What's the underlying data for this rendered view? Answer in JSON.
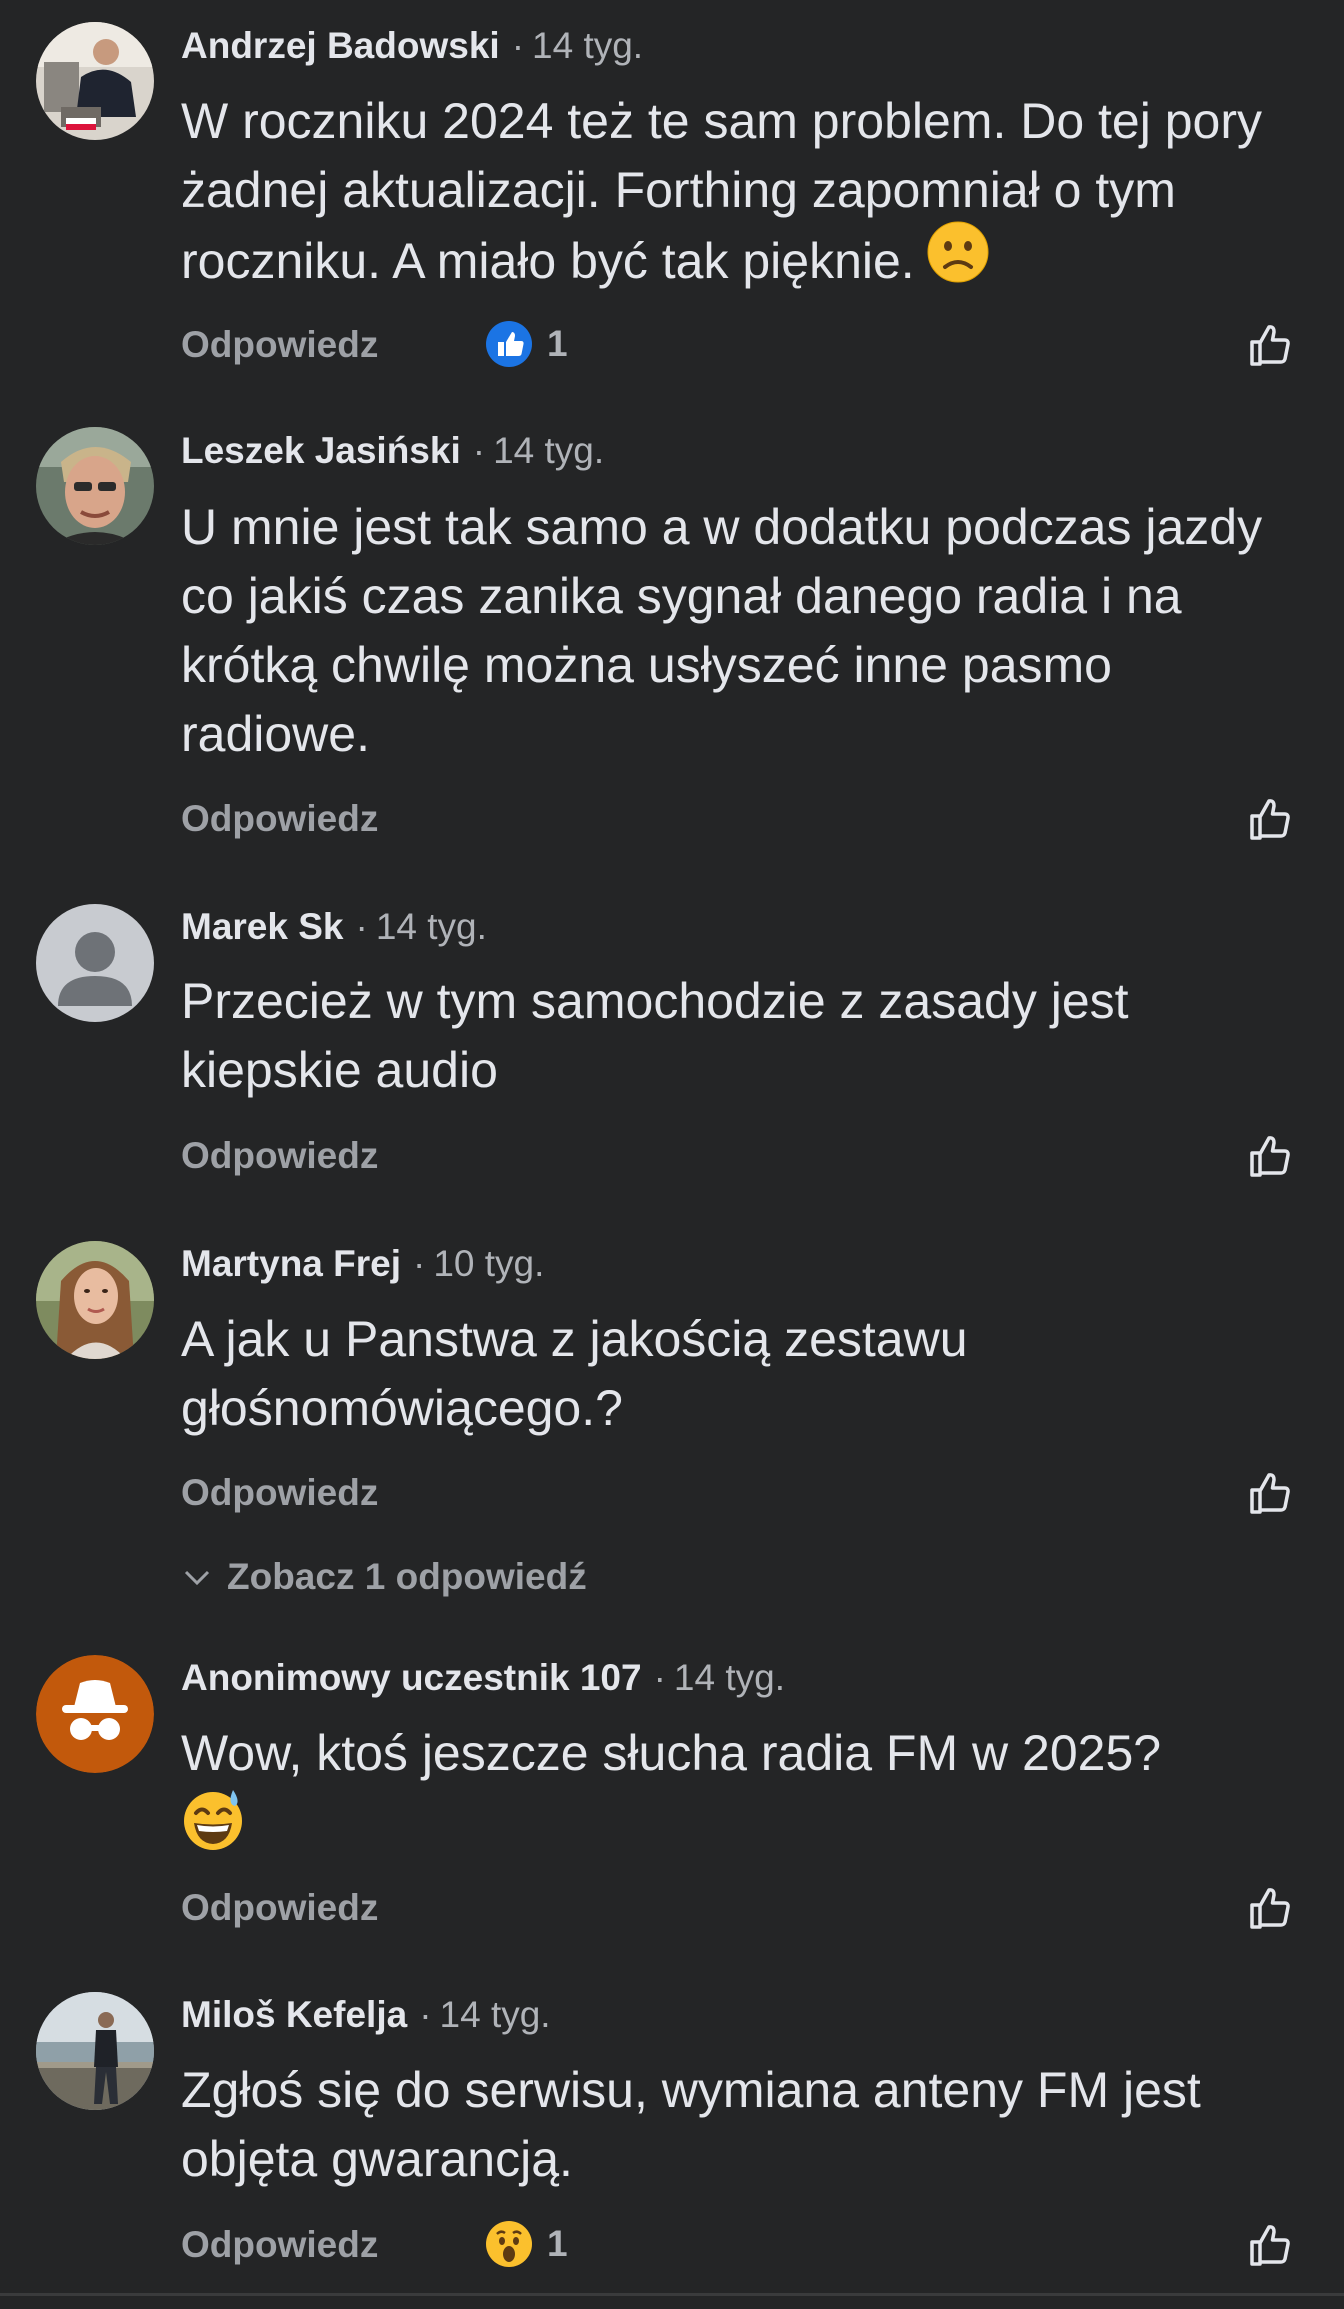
{
  "reply_label": "Odpowiedz",
  "comments": [
    {
      "author": "Andrzej Badowski",
      "separator": "·",
      "time": "14 tyg.",
      "text": "W roczniku 2024 też te sam problem. Do tej pory żadnej aktualizacji. Forthing zapomniał o tym roczniku. A miało być tak pięknie.",
      "emoji": "frowning-face",
      "reaction": {
        "icon": "like-reaction-icon",
        "count": "1"
      }
    },
    {
      "author": "Leszek Jasiński",
      "separator": "·",
      "time": "14 tyg.",
      "text": "U mnie jest tak samo a w dodatku podczas jazdy co jakiś czas zanika sygnał danego radia i na krótką chwilę można usłyszeć inne pasmo radiowe."
    },
    {
      "author": "Marek Sk",
      "separator": "·",
      "time": "14 tyg.",
      "text": "Przecież w tym samochodzie z zasady jest kiepskie audio"
    },
    {
      "author": "Martyna Frej",
      "separator": "·",
      "time": "10 tyg.",
      "text": "A jak u Panstwa z jakością zestawu głośnomówiącego.?",
      "see_replies": "Zobacz 1 odpowiedź"
    },
    {
      "author": "Anonimowy uczestnik 107",
      "separator": "·",
      "time": "14 tyg.",
      "text": "Wow, ktoś jeszcze słucha radia FM w 2025?",
      "emoji": "grinning-sweat-face"
    },
    {
      "author": "Miloš Kefelja",
      "separator": "·",
      "time": "14 tyg.",
      "text": "Zgłoś się do serwisu, wymiana anteny FM jest objęta gwarancją.",
      "reaction": {
        "icon": "wow-reaction-icon",
        "count": "1"
      }
    }
  ],
  "colors": {
    "background": "#242526",
    "text": "#e4e6eb",
    "muted": "#b0b3b8",
    "like_blue": "#1b74e4",
    "anon_orange": "#c2590c"
  }
}
